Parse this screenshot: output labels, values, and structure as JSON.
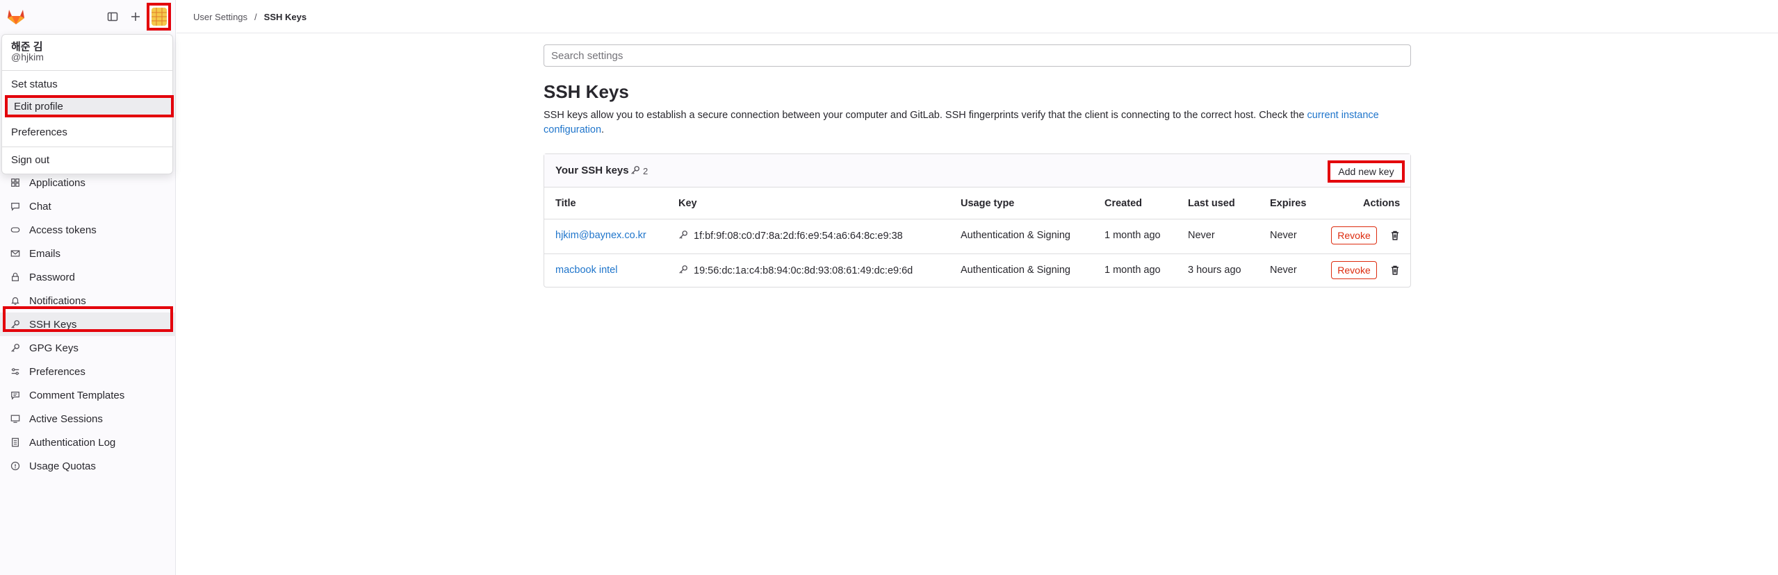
{
  "app": {
    "breadcrumb": [
      "User Settings",
      "SSH Keys"
    ],
    "breadcrumb_sep": "/"
  },
  "user_menu": {
    "name": "해준 김",
    "handle": "@hjkim",
    "items": [
      "Set status",
      "Edit profile",
      "Preferences",
      "Sign out"
    ]
  },
  "sidebar": {
    "items": [
      {
        "label": "Applications",
        "icon": "applications-icon"
      },
      {
        "label": "Chat",
        "icon": "comment-icon"
      },
      {
        "label": "Access tokens",
        "icon": "token-icon"
      },
      {
        "label": "Emails",
        "icon": "mail-icon"
      },
      {
        "label": "Password",
        "icon": "lock-icon"
      },
      {
        "label": "Notifications",
        "icon": "bell-icon"
      },
      {
        "label": "SSH Keys",
        "icon": "key-icon",
        "active": true
      },
      {
        "label": "GPG Keys",
        "icon": "key-icon"
      },
      {
        "label": "Preferences",
        "icon": "preferences-icon"
      },
      {
        "label": "Comment Templates",
        "icon": "comment-template-icon"
      },
      {
        "label": "Active Sessions",
        "icon": "monitor-icon"
      },
      {
        "label": "Authentication Log",
        "icon": "log-icon"
      },
      {
        "label": "Usage Quotas",
        "icon": "quota-icon"
      }
    ]
  },
  "main": {
    "search_placeholder": "Search settings",
    "title": "SSH Keys",
    "description": "SSH keys allow you to establish a secure connection between your computer and GitLab. SSH fingerprints verify that the client is connecting to the correct host. Check the ",
    "description_link": "current instance configuration",
    "description_end": ".",
    "card_title": "Your SSH keys",
    "key_count": "2",
    "add_button": "Add new key",
    "columns": [
      "Title",
      "Key",
      "Usage type",
      "Created",
      "Last used",
      "Expires",
      "Actions"
    ],
    "rows": [
      {
        "title": "hjkim@baynex.co.kr",
        "key": "1f:bf:9f:08:c0:d7:8a:2d:f6:e9:54:a6:64:8c:e9:38",
        "usage": "Authentication & Signing",
        "created": "1 month ago",
        "last_used": "Never",
        "expires": "Never",
        "revoke": "Revoke"
      },
      {
        "title": "macbook intel",
        "key": "19:56:dc:1a:c4:b8:94:0c:8d:93:08:61:49:dc:e9:6d",
        "usage": "Authentication & Signing",
        "created": "1 month ago",
        "last_used": "3 hours ago",
        "expires": "Never",
        "revoke": "Revoke"
      }
    ]
  },
  "colors": {
    "highlight": "#e3000b",
    "link": "#1f75cb",
    "danger": "#dd2b0e"
  }
}
